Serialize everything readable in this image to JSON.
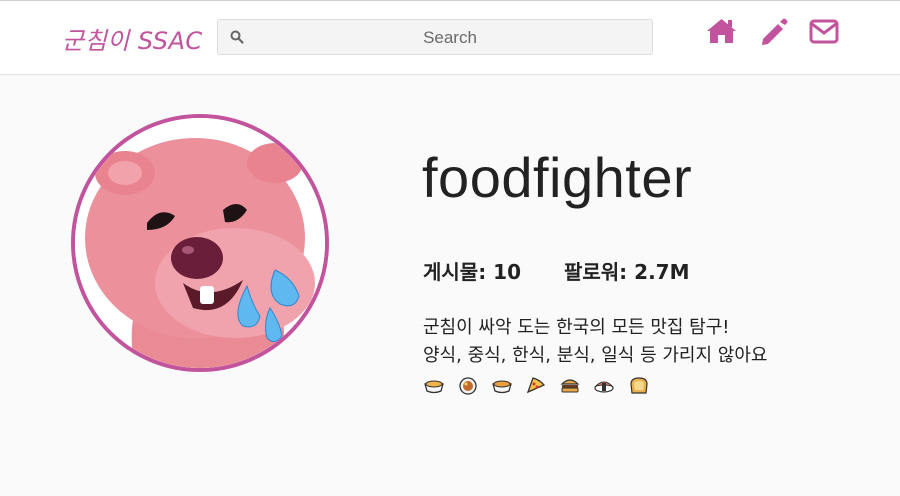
{
  "header": {
    "logo": "군침이 SSAC",
    "search": {
      "placeholder": "Search",
      "value": ""
    },
    "icons": [
      "home-icon",
      "pencil-icon",
      "mail-icon"
    ]
  },
  "colors": {
    "accent": "#c2539d",
    "background": "#fafafa"
  },
  "profile": {
    "username": "foodfighter",
    "posts_label": "게시물:",
    "posts_value": "10",
    "followers_label": "팔로워:",
    "followers_value": "2.7M",
    "bio_line1": "군침이 싸악 도는 한국의 모든 맛집 탐구!",
    "bio_line2": "양식, 중식, 한식, 분식, 일식 등 가리지 않아요",
    "emojis": [
      "ramen-icon",
      "curry-icon",
      "soup-bowl-icon",
      "pizza-icon",
      "burger-icon",
      "sushi-icon",
      "bread-icon"
    ]
  }
}
